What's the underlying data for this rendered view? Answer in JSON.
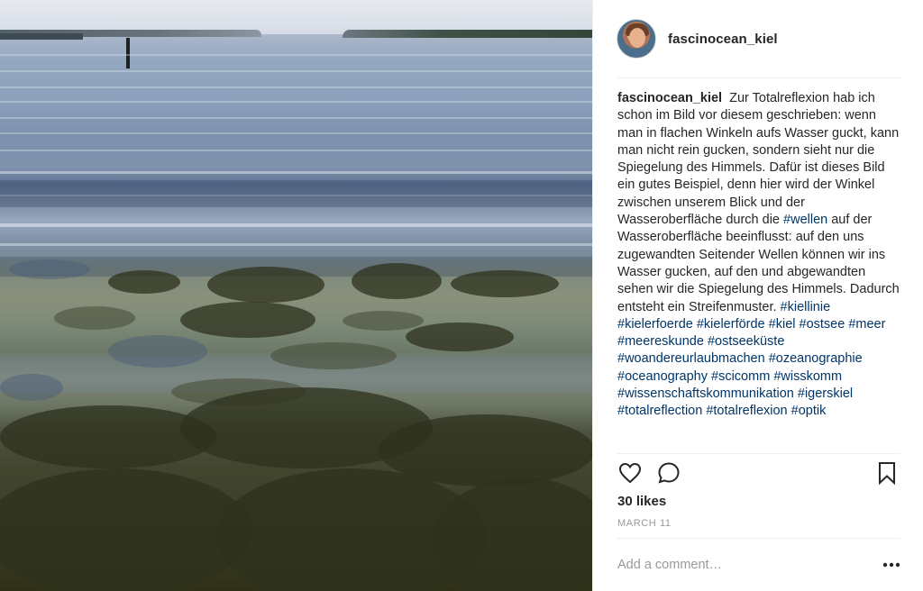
{
  "post": {
    "username": "fascinocean_kiel",
    "photo_alt": "Shallow sea water with seaweed and reflection of the sky",
    "caption": {
      "username": "fascinocean_kiel",
      "text": "Zur Totalreflexion hab ich schon im Bild vor diesem geschrieben: wenn man in flachen Winkeln aufs Wasser guckt, kann man nicht rein gucken, sondern sieht nur die Spiegelung des Himmels. Dafür ist dieses Bild ein gutes Beispiel, denn hier wird der Winkel zwischen unserem Blick und der Wasseroberfläche durch die",
      "hashtag_inline": "#wellen",
      "text_after": "auf der Wasseroberfläche beeinflusst: auf den uns zugewandten Seitender Wellen können wir ins Wasser gucken, auf den und abgewandten sehen wir die Spiegelung des Himmels. Dadurch entsteht ein Streifenmuster.",
      "hashtags": [
        "#kiellinie",
        "#kielerfoerde",
        "#kielerförde",
        "#kiel",
        "#ostsee",
        "#meer",
        "#meereskunde",
        "#ostseeküste",
        "#woandereurlaubmachen",
        "#ozeanographie",
        "#oceanography",
        "#scicomm",
        "#wisskomm",
        "#wissenschaftskommunikation",
        "#igerskiel",
        "#totalreflection",
        "#totalreflexion",
        "#optik"
      ]
    },
    "likes": "30 likes",
    "date": "MARCH 11",
    "comment_placeholder": "Add a comment…"
  },
  "icons": {
    "like": "heart-icon",
    "comment": "comment-bubble-icon",
    "save": "bookmark-icon",
    "more": "more-options-icon"
  },
  "colors": {
    "text": "#262626",
    "hashtag": "#003569",
    "muted": "#999999",
    "divider": "#efefef"
  }
}
